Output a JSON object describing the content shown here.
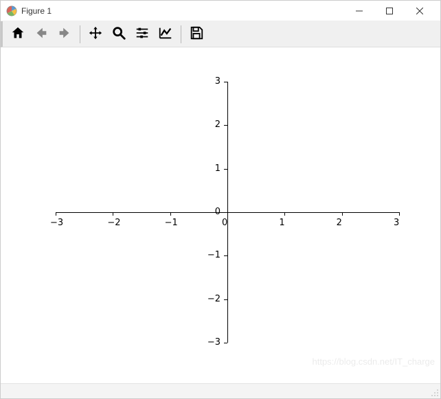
{
  "window": {
    "title": "Figure 1"
  },
  "toolbar": {
    "home": "Home",
    "back": "Back",
    "forward": "Forward",
    "pan": "Pan",
    "zoom": "Zoom",
    "subplots": "Configure subplots",
    "edit": "Edit axis",
    "save": "Save"
  },
  "watermark": "https://blog.csdn.net/IT_charge",
  "chart_data": {
    "type": "line",
    "series": [],
    "title": "",
    "xlabel": "",
    "ylabel": "",
    "xlim": [
      -3,
      3
    ],
    "ylim": [
      -3,
      3
    ],
    "xticks": [
      -3,
      -2,
      -1,
      0,
      1,
      2,
      3
    ],
    "yticks": [
      -3,
      -2,
      -1,
      0,
      1,
      2,
      3
    ],
    "spines": {
      "left": "zero",
      "bottom": "zero",
      "right": false,
      "top": false
    },
    "xtick_labels": [
      "−3",
      "−2",
      "−1",
      "0",
      "1",
      "2",
      "3"
    ],
    "ytick_labels": [
      "−3",
      "−2",
      "−1",
      "0",
      "1",
      "2",
      "3"
    ]
  }
}
